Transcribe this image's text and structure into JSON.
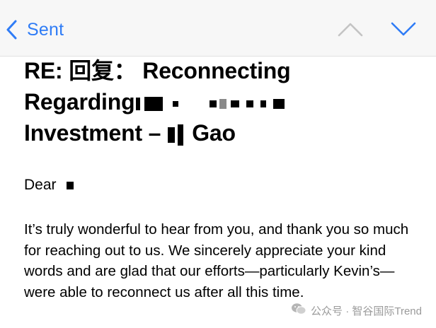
{
  "nav": {
    "back_label": "Sent",
    "back_icon": "chevron-left-icon",
    "prev_icon": "chevron-up-icon",
    "next_icon": "chevron-down-icon",
    "accent_color": "#2f7cf6"
  },
  "email": {
    "subject_line1": "RE: 回复： Reconnecting",
    "subject_line2": "Regarding",
    "subject_line3_start": "Investment –",
    "subject_line3_end": "Gao",
    "greeting": "Dear",
    "body": "It’s truly wonderful to hear from you, and thank you so much for reaching out to us. We sincerely appreciate your kind words and are glad that our efforts—particularly Kevin’s—were able to reconnect us after all this time."
  },
  "watermark": {
    "text": "公众号 · 智谷国际Trend"
  }
}
